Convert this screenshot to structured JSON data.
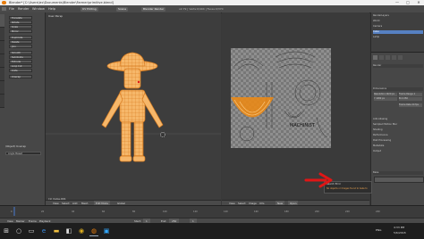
{
  "window": {
    "title": "Blender* [C:\\Users\\lec\\Documents\\Blender\\Farmer\\primitive.blend]",
    "minimize": "—",
    "maximize": "□",
    "close": "✕"
  },
  "infobar": {
    "menus": [
      "File",
      "Render",
      "Window",
      "Help"
    ],
    "engine": "Blender Render",
    "layout": "UV Editing",
    "scene": "Scene",
    "stats": "v2.79 | Verts:0/404 | Faces:0/370"
  },
  "toolshelf": {
    "tabs": [
      "Tools",
      "Create",
      "Relations",
      "Display",
      "Shading",
      "Options",
      "Grease Pencil"
    ],
    "buttons": [
      "Translate",
      "Rotate",
      "Scale",
      "Mirror",
      "Duplicate",
      "Delete",
      "Join",
      "Smooth",
      "Subdivide",
      "Extrude",
      "Loop Cut",
      "Knife",
      "Unwrap"
    ],
    "operator_label": "(Object) Unwrap",
    "operator_value": "Angle Based"
  },
  "viewport3d": {
    "label": "User Persp",
    "object_label": "(1) Cube.001",
    "header": [
      "View",
      "Select",
      "Add",
      "Mesh",
      "Edit Mode",
      "Global"
    ]
  },
  "uv_editor": {
    "label": "UV",
    "header": [
      "View",
      "Select",
      "Image",
      "UVs",
      "New",
      "Open"
    ],
    "image_label": "MACHINIST"
  },
  "properties": {
    "outliner_items": [
      "RenderLayers",
      "World",
      "Camera",
      "Cube",
      "Lamp"
    ],
    "panels": [
      "Render",
      "Dimensions",
      "Anti-Aliasing",
      "Sampled Motion Blur",
      "Shading",
      "Performance",
      "Post Processing",
      "Metadata",
      "Output",
      "Bake"
    ],
    "fields": [
      {
        "label": "Resolution",
        "value": "1920 px"
      },
      {
        "label": "Y",
        "value": "1080 px"
      },
      {
        "label": "Frame Range",
        "value": "1"
      },
      {
        "label": "End",
        "value": "250"
      },
      {
        "label": "Frame Rate",
        "value": "24 fps"
      }
    ]
  },
  "notification": {
    "title": "Search Error",
    "message": "No objects or Images found to bake to"
  },
  "timeline": {
    "header": [
      "View",
      "Marker",
      "Frame",
      "Playback"
    ],
    "start_label": "Start:",
    "start": "1",
    "end_label": "End:",
    "end": "250",
    "current": "1",
    "ticks": [
      "0",
      "20",
      "40",
      "60",
      "80",
      "100",
      "120",
      "140",
      "160",
      "180",
      "200",
      "220",
      "240"
    ]
  },
  "taskbar": {
    "icons": [
      "windows-start",
      "search",
      "task-view",
      "edge",
      "explorer",
      "store",
      "chrome",
      "blender",
      "photoshop"
    ],
    "clock": "4:33 PM",
    "date": "5/6/2018",
    "lang": "ENG"
  },
  "colors": {
    "mesh_fill": "#f6b76a",
    "mesh_edge": "#d77a1e",
    "selection": "#f08a10",
    "arrow": "#e01616",
    "accent_blue": "#5680c2"
  }
}
